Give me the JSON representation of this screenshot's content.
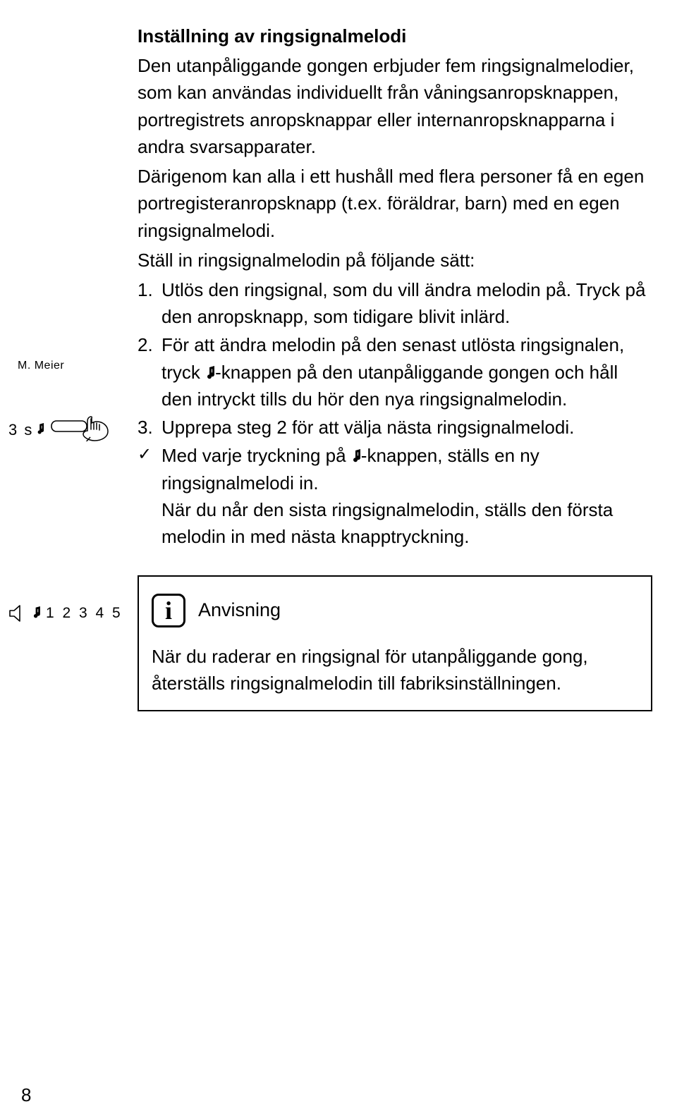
{
  "sidebar": {
    "label_meier": "M. Meier",
    "press_duration": "3 s",
    "melody_sequence": "1 2 3 4 5"
  },
  "content": {
    "title": "Inställning av ringsignalmelodi",
    "intro": "Den utanpåliggande gongen erbjuder fem ring­signalmelodier, som kan användas individuellt från våningsanropsknappen, portregistrets anropsknappar eller internanropsknapparna i andra svarsapparater.",
    "para2": "Därigenom kan alla i ett hushåll med flera perso­ner få en egen portregisteranropsknapp (t.ex. föräldrar, barn) med en egen ringsignalmelodi.",
    "para3": "Ställ in ringsignalmelodin på följande sätt:",
    "steps": [
      {
        "num": "1.",
        "text": "Utlös den ringsignal, som du vill ändra melo­din på. Tryck på den anropsknapp, som tidi­gare blivit inlärd."
      },
      {
        "num": "2.",
        "before": "För att ändra melodin på den senast utlösta ringsignalen, tryck ",
        "after": "-knappen på den utan­påliggande gongen och håll den intryckt tills du hör den nya ringsignalmelodin."
      },
      {
        "num": "3.",
        "text": "Upprepa steg 2 för att välja nästa ringsignal­melodi."
      }
    ],
    "check": {
      "mark": "✓",
      "before": "Med varje tryckning på ",
      "after1": "-knappen, ställs en ny ringsignalmelodi in.",
      "line2": "När du når den sista ringsignalmelodin, ställs den första melodin in med nästa knapptryck­ning."
    },
    "info": {
      "title": "Anvisning",
      "body": "När du raderar en ringsignal för utanpåliggande gong, återställs ringsignalmelodin till fabriksin­ställningen."
    }
  },
  "page_number": "8"
}
